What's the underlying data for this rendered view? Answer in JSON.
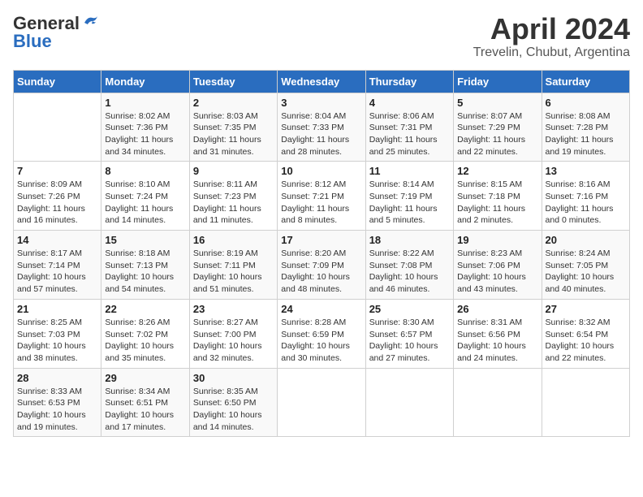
{
  "header": {
    "logo_general": "General",
    "logo_blue": "Blue",
    "title": "April 2024",
    "subtitle": "Trevelin, Chubut, Argentina"
  },
  "days_of_week": [
    "Sunday",
    "Monday",
    "Tuesday",
    "Wednesday",
    "Thursday",
    "Friday",
    "Saturday"
  ],
  "weeks": [
    [
      {
        "day": "",
        "sunrise": "",
        "sunset": "",
        "daylight": ""
      },
      {
        "day": "1",
        "sunrise": "Sunrise: 8:02 AM",
        "sunset": "Sunset: 7:36 PM",
        "daylight": "Daylight: 11 hours and 34 minutes."
      },
      {
        "day": "2",
        "sunrise": "Sunrise: 8:03 AM",
        "sunset": "Sunset: 7:35 PM",
        "daylight": "Daylight: 11 hours and 31 minutes."
      },
      {
        "day": "3",
        "sunrise": "Sunrise: 8:04 AM",
        "sunset": "Sunset: 7:33 PM",
        "daylight": "Daylight: 11 hours and 28 minutes."
      },
      {
        "day": "4",
        "sunrise": "Sunrise: 8:06 AM",
        "sunset": "Sunset: 7:31 PM",
        "daylight": "Daylight: 11 hours and 25 minutes."
      },
      {
        "day": "5",
        "sunrise": "Sunrise: 8:07 AM",
        "sunset": "Sunset: 7:29 PM",
        "daylight": "Daylight: 11 hours and 22 minutes."
      },
      {
        "day": "6",
        "sunrise": "Sunrise: 8:08 AM",
        "sunset": "Sunset: 7:28 PM",
        "daylight": "Daylight: 11 hours and 19 minutes."
      }
    ],
    [
      {
        "day": "7",
        "sunrise": "Sunrise: 8:09 AM",
        "sunset": "Sunset: 7:26 PM",
        "daylight": "Daylight: 11 hours and 16 minutes."
      },
      {
        "day": "8",
        "sunrise": "Sunrise: 8:10 AM",
        "sunset": "Sunset: 7:24 PM",
        "daylight": "Daylight: 11 hours and 14 minutes."
      },
      {
        "day": "9",
        "sunrise": "Sunrise: 8:11 AM",
        "sunset": "Sunset: 7:23 PM",
        "daylight": "Daylight: 11 hours and 11 minutes."
      },
      {
        "day": "10",
        "sunrise": "Sunrise: 8:12 AM",
        "sunset": "Sunset: 7:21 PM",
        "daylight": "Daylight: 11 hours and 8 minutes."
      },
      {
        "day": "11",
        "sunrise": "Sunrise: 8:14 AM",
        "sunset": "Sunset: 7:19 PM",
        "daylight": "Daylight: 11 hours and 5 minutes."
      },
      {
        "day": "12",
        "sunrise": "Sunrise: 8:15 AM",
        "sunset": "Sunset: 7:18 PM",
        "daylight": "Daylight: 11 hours and 2 minutes."
      },
      {
        "day": "13",
        "sunrise": "Sunrise: 8:16 AM",
        "sunset": "Sunset: 7:16 PM",
        "daylight": "Daylight: 11 hours and 0 minutes."
      }
    ],
    [
      {
        "day": "14",
        "sunrise": "Sunrise: 8:17 AM",
        "sunset": "Sunset: 7:14 PM",
        "daylight": "Daylight: 10 hours and 57 minutes."
      },
      {
        "day": "15",
        "sunrise": "Sunrise: 8:18 AM",
        "sunset": "Sunset: 7:13 PM",
        "daylight": "Daylight: 10 hours and 54 minutes."
      },
      {
        "day": "16",
        "sunrise": "Sunrise: 8:19 AM",
        "sunset": "Sunset: 7:11 PM",
        "daylight": "Daylight: 10 hours and 51 minutes."
      },
      {
        "day": "17",
        "sunrise": "Sunrise: 8:20 AM",
        "sunset": "Sunset: 7:09 PM",
        "daylight": "Daylight: 10 hours and 48 minutes."
      },
      {
        "day": "18",
        "sunrise": "Sunrise: 8:22 AM",
        "sunset": "Sunset: 7:08 PM",
        "daylight": "Daylight: 10 hours and 46 minutes."
      },
      {
        "day": "19",
        "sunrise": "Sunrise: 8:23 AM",
        "sunset": "Sunset: 7:06 PM",
        "daylight": "Daylight: 10 hours and 43 minutes."
      },
      {
        "day": "20",
        "sunrise": "Sunrise: 8:24 AM",
        "sunset": "Sunset: 7:05 PM",
        "daylight": "Daylight: 10 hours and 40 minutes."
      }
    ],
    [
      {
        "day": "21",
        "sunrise": "Sunrise: 8:25 AM",
        "sunset": "Sunset: 7:03 PM",
        "daylight": "Daylight: 10 hours and 38 minutes."
      },
      {
        "day": "22",
        "sunrise": "Sunrise: 8:26 AM",
        "sunset": "Sunset: 7:02 PM",
        "daylight": "Daylight: 10 hours and 35 minutes."
      },
      {
        "day": "23",
        "sunrise": "Sunrise: 8:27 AM",
        "sunset": "Sunset: 7:00 PM",
        "daylight": "Daylight: 10 hours and 32 minutes."
      },
      {
        "day": "24",
        "sunrise": "Sunrise: 8:28 AM",
        "sunset": "Sunset: 6:59 PM",
        "daylight": "Daylight: 10 hours and 30 minutes."
      },
      {
        "day": "25",
        "sunrise": "Sunrise: 8:30 AM",
        "sunset": "Sunset: 6:57 PM",
        "daylight": "Daylight: 10 hours and 27 minutes."
      },
      {
        "day": "26",
        "sunrise": "Sunrise: 8:31 AM",
        "sunset": "Sunset: 6:56 PM",
        "daylight": "Daylight: 10 hours and 24 minutes."
      },
      {
        "day": "27",
        "sunrise": "Sunrise: 8:32 AM",
        "sunset": "Sunset: 6:54 PM",
        "daylight": "Daylight: 10 hours and 22 minutes."
      }
    ],
    [
      {
        "day": "28",
        "sunrise": "Sunrise: 8:33 AM",
        "sunset": "Sunset: 6:53 PM",
        "daylight": "Daylight: 10 hours and 19 minutes."
      },
      {
        "day": "29",
        "sunrise": "Sunrise: 8:34 AM",
        "sunset": "Sunset: 6:51 PM",
        "daylight": "Daylight: 10 hours and 17 minutes."
      },
      {
        "day": "30",
        "sunrise": "Sunrise: 8:35 AM",
        "sunset": "Sunset: 6:50 PM",
        "daylight": "Daylight: 10 hours and 14 minutes."
      },
      {
        "day": "",
        "sunrise": "",
        "sunset": "",
        "daylight": ""
      },
      {
        "day": "",
        "sunrise": "",
        "sunset": "",
        "daylight": ""
      },
      {
        "day": "",
        "sunrise": "",
        "sunset": "",
        "daylight": ""
      },
      {
        "day": "",
        "sunrise": "",
        "sunset": "",
        "daylight": ""
      }
    ]
  ]
}
